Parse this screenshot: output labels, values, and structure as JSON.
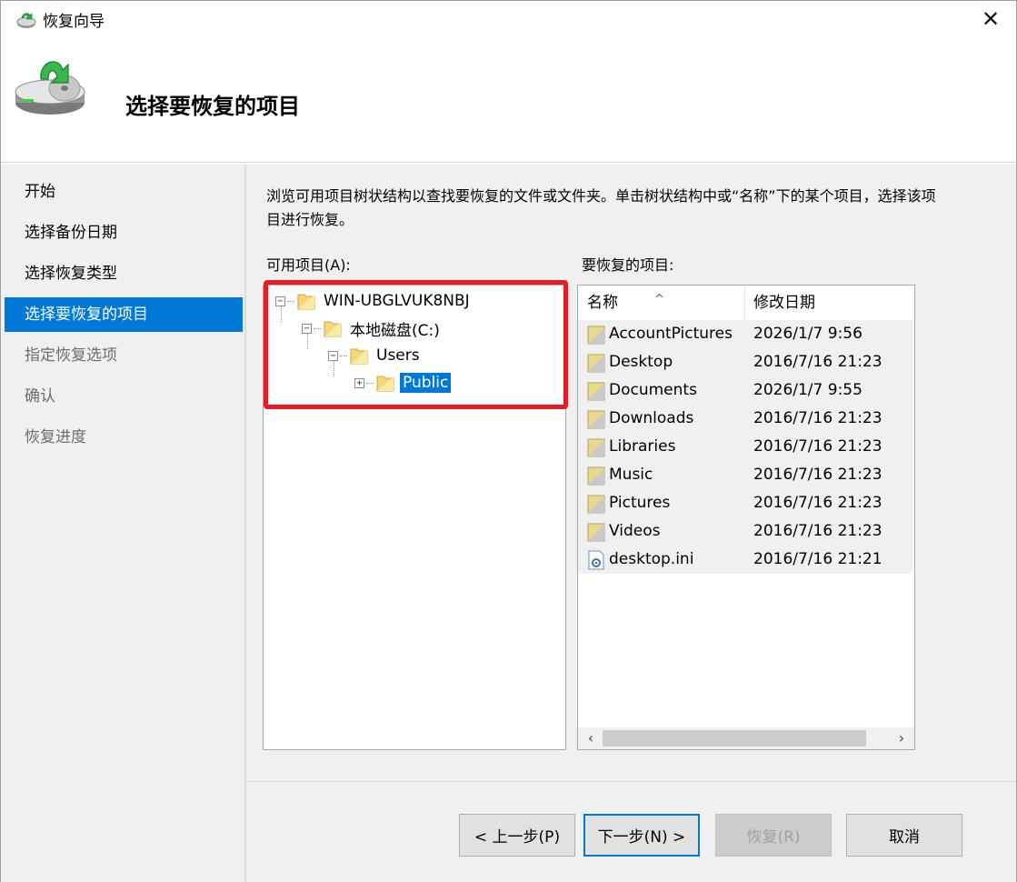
{
  "window": {
    "title": "恢复向导",
    "close_glyph": "✕"
  },
  "header": {
    "title": "选择要恢复的项目",
    "icon": "backup-restore-icon"
  },
  "nav": {
    "items": [
      {
        "label": "开始",
        "state": "done"
      },
      {
        "label": "选择备份日期",
        "state": "done"
      },
      {
        "label": "选择恢复类型",
        "state": "done"
      },
      {
        "label": "选择要恢复的项目",
        "state": "active"
      },
      {
        "label": "指定恢复选项",
        "state": "pending"
      },
      {
        "label": "确认",
        "state": "pending"
      },
      {
        "label": "恢复进度",
        "state": "pending"
      }
    ]
  },
  "main": {
    "description": "浏览可用项目树状结构以查找要恢复的文件或文件夹。单击树状结构中或“名称”下的某个项目，选择该项目进行恢复。",
    "available_label": "可用项目(A):",
    "restore_label": "要恢复的项目:",
    "tree": [
      {
        "label": "WIN-UBGLVUK8NBJ",
        "expander": "−",
        "selected": false
      },
      {
        "label": "本地磁盘(C:)",
        "expander": "−",
        "selected": false
      },
      {
        "label": "Users",
        "expander": "−",
        "selected": false
      },
      {
        "label": "Public",
        "expander": "+",
        "selected": true
      }
    ],
    "list": {
      "columns": {
        "name": "名称",
        "modified": "修改日期"
      },
      "sort_glyph": "^",
      "rows": [
        {
          "name": "AccountPictures",
          "date": "2026/1/7 9:56",
          "type": "folder"
        },
        {
          "name": "Desktop",
          "date": "2016/7/16 21:23",
          "type": "folder"
        },
        {
          "name": "Documents",
          "date": "2026/1/7 9:55",
          "type": "folder"
        },
        {
          "name": "Downloads",
          "date": "2016/7/16 21:23",
          "type": "folder"
        },
        {
          "name": "Libraries",
          "date": "2016/7/16 21:23",
          "type": "folder"
        },
        {
          "name": "Music",
          "date": "2016/7/16 21:23",
          "type": "folder"
        },
        {
          "name": "Pictures",
          "date": "2016/7/16 21:23",
          "type": "folder"
        },
        {
          "name": "Videos",
          "date": "2016/7/16 21:23",
          "type": "folder"
        },
        {
          "name": "desktop.ini",
          "date": "2016/7/16 21:21",
          "type": "ini-file"
        }
      ],
      "scroll_left": "‹",
      "scroll_right": "›"
    }
  },
  "buttons": {
    "back": "< 上一步(P)",
    "next": "下一步(N) >",
    "restore": "恢复(R)",
    "cancel": "取消"
  },
  "colors": {
    "accent": "#0078d7",
    "highlight_box": "#e61b23"
  }
}
